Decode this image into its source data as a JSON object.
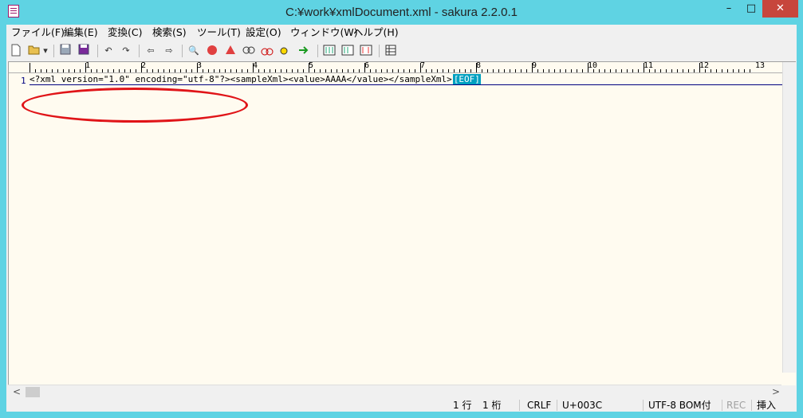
{
  "window": {
    "title": "C:¥work¥xmlDocument.xml - sakura 2.2.0.1",
    "min_symbol": "–",
    "max_symbol": "□",
    "close_symbol": "✕"
  },
  "menu": [
    "ファイル(F)",
    "編集(E)",
    "変換(C)",
    "検索(S)",
    "ツール(T)",
    "設定(O)",
    "ウィンドウ(W)",
    "ヘルプ(H)"
  ],
  "toolbar": {
    "icons": [
      "new-file-icon",
      "open-file-icon",
      "open-dropdown-icon",
      "save-icon",
      "save-all-icon",
      "undo-icon",
      "redo-icon",
      "jump-back-icon",
      "jump-forward-icon",
      "search-icon",
      "search-prev-icon",
      "search-next-icon",
      "search-replace-icon",
      "mark-icon",
      "grep-icon",
      "outline-icon",
      "compare-icon",
      "tag-jump-icon",
      "property-icon",
      "settings-grid-icon"
    ]
  },
  "ruler": {
    "labels": [
      "1",
      "2",
      "3",
      "4",
      "5",
      "6",
      "7",
      "8",
      "9",
      "10",
      "11",
      "12",
      "13"
    ]
  },
  "editor": {
    "line_number": "1",
    "line_text": "<?xml version=\"1.0\" encoding=\"utf-8\"?><sampleXml><value>AAAA</value></sampleXml>",
    "eof_marker": "[EOF]"
  },
  "scrollbar": {
    "left_arrow": "<",
    "right_arrow": ">"
  },
  "status": {
    "row": "1 行",
    "col": "1 桁",
    "eol": "CRLF",
    "codepoint": "U+003C",
    "encoding": "UTF-8 BOM付",
    "rec": "REC",
    "mode": "挿入"
  },
  "colors": {
    "title_bar": "#5fd3e3",
    "editor_bg": "#fffbf0",
    "eof_bg": "#00a0c0",
    "annotation": "#e01418",
    "close_button": "#c7463c"
  }
}
